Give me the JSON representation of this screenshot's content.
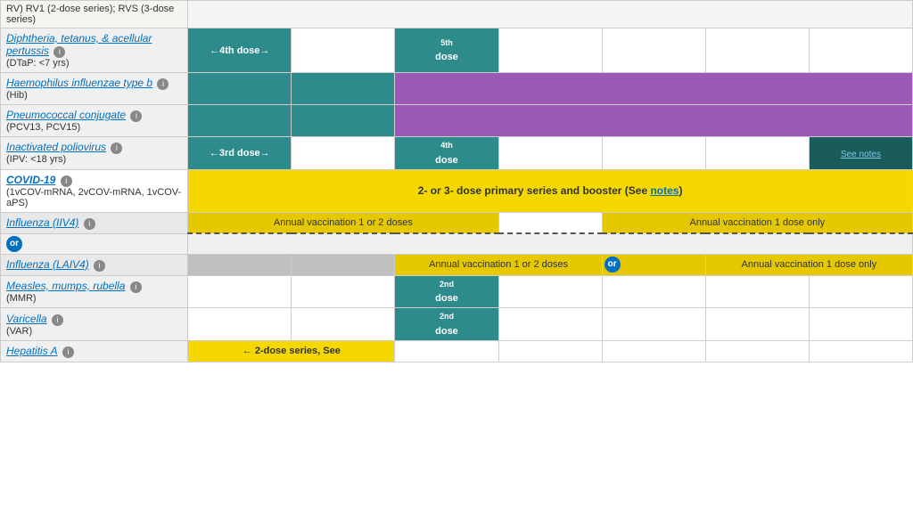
{
  "rows": [
    {
      "id": "rv-partial",
      "name": "",
      "sub": "RV) RV1 (2-dose series); RVS (3-dose series)",
      "cells": [
        {
          "type": "empty",
          "text": "",
          "colspan": 1
        },
        {
          "type": "empty",
          "text": "",
          "colspan": 1
        },
        {
          "type": "empty",
          "text": "",
          "colspan": 1
        },
        {
          "type": "empty",
          "text": "",
          "colspan": 1
        },
        {
          "type": "empty",
          "text": "",
          "colspan": 1
        },
        {
          "type": "empty",
          "text": "",
          "colspan": 1
        },
        {
          "type": "empty",
          "text": "",
          "colspan": 1
        }
      ]
    },
    {
      "id": "dtap",
      "name": "Diphtheria, tetanus, & acellular pertussis",
      "sub": "(DTaP: <7 yrs)",
      "cells": [
        {
          "type": "teal",
          "text": "←4th dose→",
          "colspan": 1
        },
        {
          "type": "empty",
          "text": "",
          "colspan": 1
        },
        {
          "type": "teal",
          "text": "5th\ndose",
          "colspan": 1
        },
        {
          "type": "empty",
          "text": "",
          "colspan": 1
        },
        {
          "type": "empty",
          "text": "",
          "colspan": 1
        },
        {
          "type": "empty",
          "text": "",
          "colspan": 1
        },
        {
          "type": "empty",
          "text": "",
          "colspan": 1
        }
      ]
    },
    {
      "id": "hib",
      "name": "Haemophilus influenzae type b",
      "sub": "(Hib)",
      "cells": [
        {
          "type": "teal",
          "text": "",
          "colspan": 1
        },
        {
          "type": "teal",
          "text": "",
          "colspan": 1
        },
        {
          "type": "purple",
          "text": "",
          "colspan": 5
        }
      ]
    },
    {
      "id": "pcv",
      "name": "Pneumococcal conjugate",
      "sub": "(PCV13, PCV15)",
      "cells": [
        {
          "type": "teal",
          "text": "",
          "colspan": 1
        },
        {
          "type": "teal",
          "text": "",
          "colspan": 1
        },
        {
          "type": "purple",
          "text": "",
          "colspan": 5
        }
      ]
    },
    {
      "id": "ipv",
      "name": "Inactivated poliovirus",
      "sub": "(IPV: <18 yrs)",
      "cells": [
        {
          "type": "teal",
          "text": "←3rd dose→",
          "colspan": 1
        },
        {
          "type": "empty",
          "text": "",
          "colspan": 1
        },
        {
          "type": "teal",
          "text": "4th\ndose",
          "colspan": 1
        },
        {
          "type": "empty",
          "text": "",
          "colspan": 1
        },
        {
          "type": "empty",
          "text": "",
          "colspan": 1
        },
        {
          "type": "empty",
          "text": "",
          "colspan": 1
        },
        {
          "type": "dark-teal",
          "text": "See\nnotes",
          "colspan": 1
        }
      ]
    },
    {
      "id": "covid",
      "name": "COVID-19",
      "sub": "(1vCOV-mRNA, 2vCOV-mRNA, 1vCOV-aPS)",
      "cells": [
        {
          "type": "yellow-bright",
          "text": "2- or 3- dose primary series and booster (See notes)",
          "colspan": 7
        }
      ]
    },
    {
      "id": "flu-iiv",
      "name": "Influenza (IIV4)",
      "sub": "",
      "cells": [
        {
          "type": "yellow-medium",
          "text": "Annual vaccination 1 or 2 doses",
          "colspan": 3
        },
        {
          "type": "empty",
          "text": "",
          "colspan": 1
        },
        {
          "type": "yellow-medium",
          "text": "Annual vaccination 1 dose only",
          "colspan": 3
        }
      ]
    },
    {
      "id": "or-row",
      "name": "or",
      "sub": "",
      "cells": []
    },
    {
      "id": "flu-laiv",
      "name": "Influenza (LAIV4)",
      "sub": "",
      "cells": [
        {
          "type": "gray-cell",
          "text": "",
          "colspan": 1
        },
        {
          "type": "gray-cell",
          "text": "",
          "colspan": 1
        },
        {
          "type": "yellow-medium",
          "text": "Annual vaccination 1 or 2 doses",
          "colspan": 2
        },
        {
          "type": "yellow-medium",
          "text": "Annual vaccination 1 dose only",
          "colspan": 3
        }
      ]
    },
    {
      "id": "mmr",
      "name": "Measles, mumps, rubella",
      "sub": "(MMR)",
      "cells": [
        {
          "type": "empty",
          "text": "",
          "colspan": 1
        },
        {
          "type": "empty",
          "text": "",
          "colspan": 1
        },
        {
          "type": "teal",
          "text": "2nd\ndose",
          "colspan": 1
        },
        {
          "type": "empty",
          "text": "",
          "colspan": 1
        },
        {
          "type": "empty",
          "text": "",
          "colspan": 1
        },
        {
          "type": "empty",
          "text": "",
          "colspan": 1
        },
        {
          "type": "empty",
          "text": "",
          "colspan": 1
        }
      ]
    },
    {
      "id": "varicella",
      "name": "Varicella",
      "sub": "(VAR)",
      "cells": [
        {
          "type": "empty",
          "text": "",
          "colspan": 1
        },
        {
          "type": "empty",
          "text": "",
          "colspan": 1
        },
        {
          "type": "teal",
          "text": "2nd\ndose",
          "colspan": 1
        },
        {
          "type": "empty",
          "text": "",
          "colspan": 1
        },
        {
          "type": "empty",
          "text": "",
          "colspan": 1
        },
        {
          "type": "empty",
          "text": "",
          "colspan": 1
        },
        {
          "type": "empty",
          "text": "",
          "colspan": 1
        }
      ]
    },
    {
      "id": "hepa",
      "name": "Hepatitis A",
      "sub": "",
      "cells": [
        {
          "type": "yellow-bright",
          "text": "← 2-dose series, See",
          "colspan": 2
        },
        {
          "type": "empty",
          "text": "",
          "colspan": 1
        },
        {
          "type": "empty",
          "text": "",
          "colspan": 1
        },
        {
          "type": "empty",
          "text": "",
          "colspan": 1
        },
        {
          "type": "empty",
          "text": "",
          "colspan": 1
        },
        {
          "type": "empty",
          "text": "",
          "colspan": 1
        }
      ]
    }
  ],
  "labels": {
    "or": "or",
    "see_notes": "notes",
    "covid_text": "2- or 3- dose primary series and booster (See notes)",
    "flu_iiv_left": "Annual vaccination 1 or 2 doses",
    "flu_iiv_right": "Annual vaccination 1 dose only",
    "flu_laiv_mid": "Annual vaccination 1 or 2 doses",
    "flu_laiv_right": "Annual vaccination 1 dose only",
    "hepa_text": "← 2-dose series, See",
    "dtap_4th": "←4th dose→",
    "dtap_5th": "5th",
    "dtap_5th_sub": "dose",
    "ipv_3rd": "←3rd dose→",
    "ipv_4th": "4th",
    "ipv_4th_sub": "dose",
    "ipv_notes": "See\nnotes",
    "mmr_2nd": "2nd",
    "mmr_2nd_sub": "dose",
    "var_2nd": "2nd",
    "var_2nd_sub": "dose"
  }
}
